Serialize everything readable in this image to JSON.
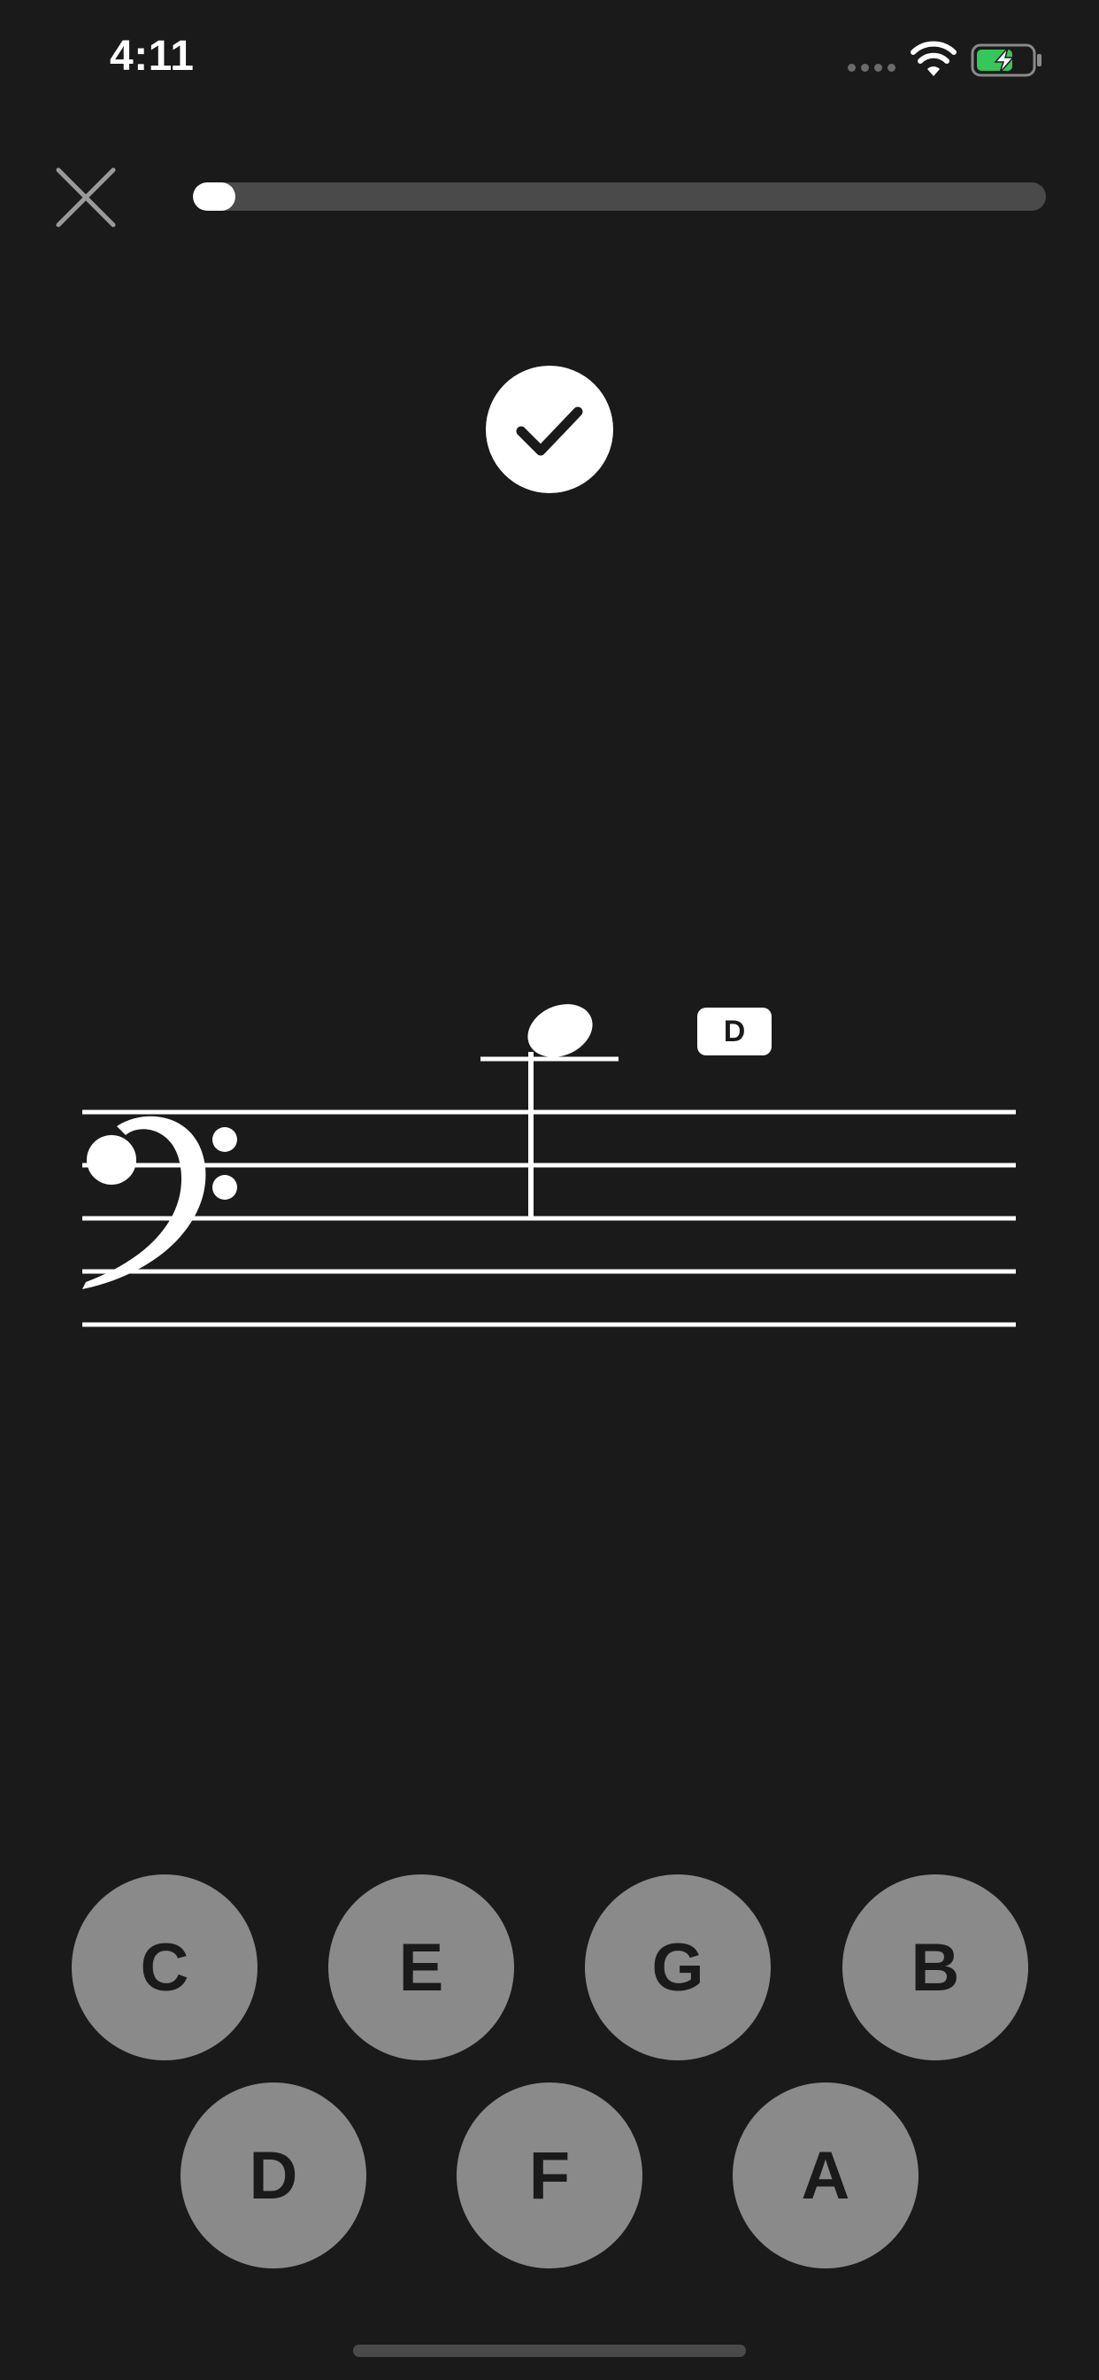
{
  "status_bar": {
    "time": "4:11",
    "battery_color": "#34c759"
  },
  "progress": {
    "value": 0.04
  },
  "feedback": {
    "state": "correct",
    "icon": "checkmark-icon"
  },
  "staff": {
    "clef": "bass",
    "note": "D",
    "revealed_label": "D"
  },
  "answers": {
    "row1": [
      "C",
      "E",
      "G",
      "B"
    ],
    "row2": [
      "D",
      "F",
      "A"
    ]
  },
  "colors": {
    "background": "#1a1a1a",
    "button": "#8a8a8a",
    "track": "#4a4a4a"
  }
}
